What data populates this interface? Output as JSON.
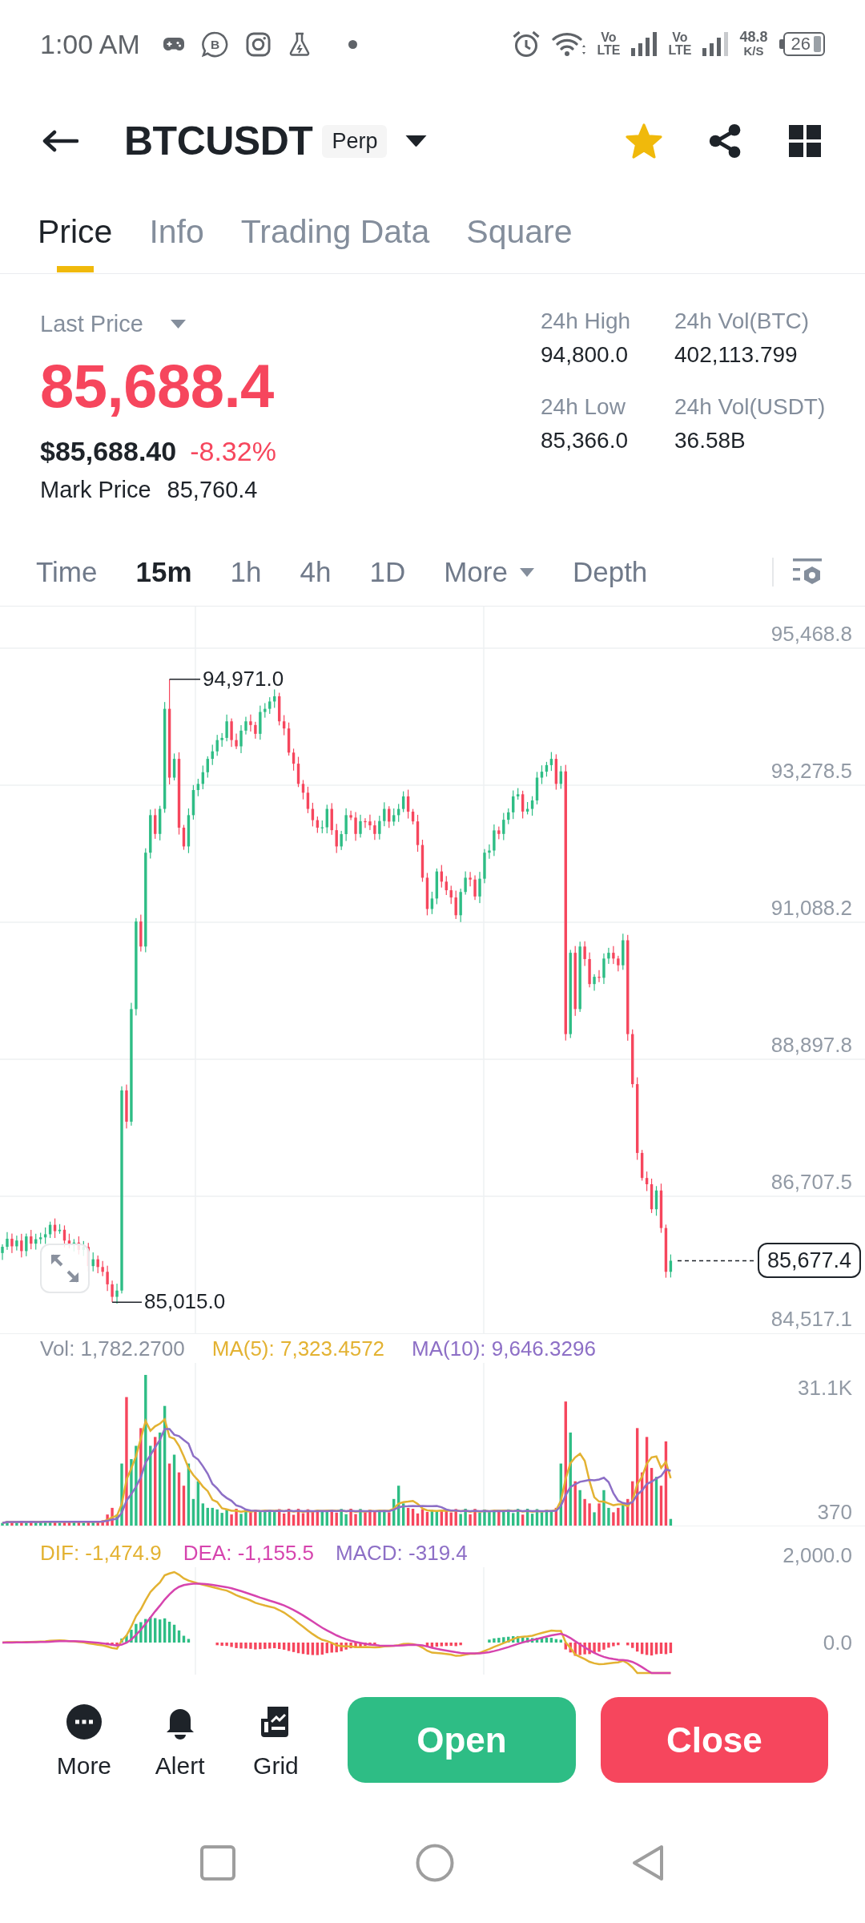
{
  "status_bar": {
    "time": "1:00 AM",
    "app_letter": "B",
    "sims": [
      {
        "top": "Vo",
        "bottom": "LTE"
      },
      {
        "top": "Vo",
        "bottom": "LTE"
      }
    ],
    "speed": {
      "value": "48.8",
      "unit": "K/S"
    },
    "battery": "26"
  },
  "header": {
    "symbol": "BTCUSDT",
    "badge": "Perp",
    "favorite": true
  },
  "tabs": [
    {
      "label": "Price",
      "selected": true
    },
    {
      "label": "Info",
      "selected": false
    },
    {
      "label": "Trading Data",
      "selected": false
    },
    {
      "label": "Square",
      "selected": false
    }
  ],
  "ticker": {
    "label": "Last Price",
    "price": "85,688.4",
    "falling": true,
    "fiat_price": "$85,688.40",
    "change": "-8.32%",
    "mark_label": "Mark Price",
    "mark_price": "85,760.4"
  },
  "stats": [
    {
      "label": "24h High",
      "value": "94,800.0"
    },
    {
      "label": "24h Vol(BTC)",
      "value": "402,113.799"
    },
    {
      "label": "24h Low",
      "value": "85,366.0"
    },
    {
      "label": "24h Vol(USDT)",
      "value": "36.58B"
    }
  ],
  "intervals": [
    {
      "label": "Time",
      "selected": false,
      "kind": "option"
    },
    {
      "label": "15m",
      "selected": true,
      "kind": "option"
    },
    {
      "label": "1h",
      "selected": false,
      "kind": "option"
    },
    {
      "label": "4h",
      "selected": false,
      "kind": "option"
    },
    {
      "label": "1D",
      "selected": false,
      "kind": "option"
    },
    {
      "label": "More",
      "selected": false,
      "kind": "dropdown"
    },
    {
      "label": "Depth",
      "selected": false,
      "kind": "option"
    }
  ],
  "price_chart": {
    "axis": [
      "95,468.8",
      "93,278.5",
      "91,088.2",
      "88,897.8",
      "86,707.5",
      "84,517.1"
    ],
    "high": "94,971.0",
    "low": "85,015.0",
    "last": "85,677.4"
  },
  "volume": {
    "legend": [
      {
        "text": "Vol: 1,782.2700",
        "color": "#8a919e"
      },
      {
        "text": "MA(5): 7,323.4572",
        "color": "#e3b232"
      },
      {
        "text": "MA(10): 9,646.3296",
        "color": "#8d6fc6"
      }
    ],
    "axis": [
      "31.1K",
      "370"
    ]
  },
  "macd": {
    "legend": [
      {
        "text": "DIF: -1,474.9",
        "color": "#e3b232"
      },
      {
        "text": "DEA: -1,155.5",
        "color": "#d644ae"
      },
      {
        "text": "MACD: -319.4",
        "color": "#8d6fc6"
      }
    ],
    "axis": [
      "2,000.0",
      "0.0"
    ]
  },
  "actions": [
    {
      "label": "More"
    },
    {
      "label": "Alert"
    },
    {
      "label": "Grid"
    }
  ],
  "trade_buttons": [
    {
      "label": "Open",
      "kind": "buy"
    },
    {
      "label": "Close",
      "kind": "sell"
    }
  ]
}
